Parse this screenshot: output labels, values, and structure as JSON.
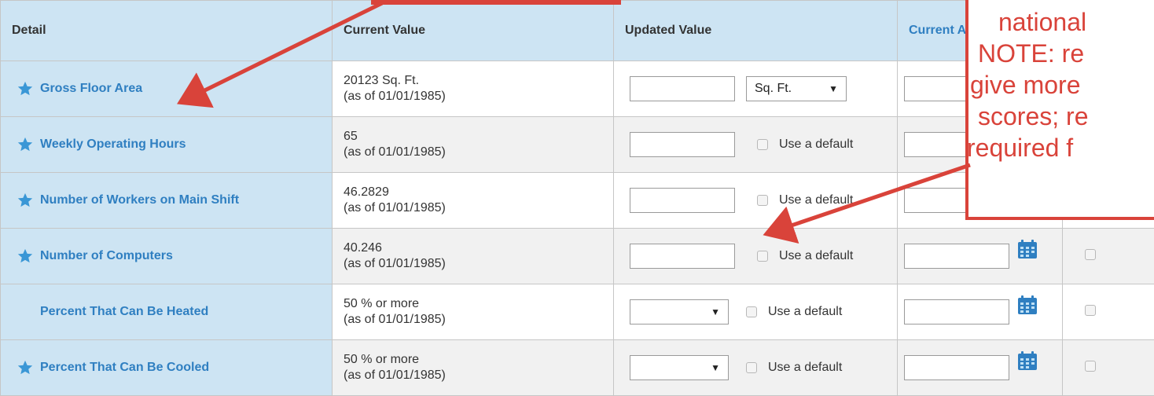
{
  "table": {
    "headers": {
      "detail": "Detail",
      "current_value": "Current Value",
      "updated_value": "Updated Value",
      "current_as_of": "Current As O"
    },
    "rows": [
      {
        "label": "Gross Floor Area",
        "star": true,
        "value": "20123 Sq. Ft.",
        "asof": "(as of 01/01/1985)",
        "kind": "unit",
        "unit": "Sq. Ft.",
        "has_date": false
      },
      {
        "label": "Weekly Operating Hours",
        "star": true,
        "value": "65",
        "asof": "(as of 01/01/1985)",
        "kind": "text_default",
        "default_label": "Use a default",
        "has_date": false
      },
      {
        "label": "Number of Workers on Main Shift",
        "star": true,
        "value": "46.2829",
        "asof": "(as of 01/01/1985)",
        "kind": "text_default",
        "default_label": "Use a default",
        "has_date": false
      },
      {
        "label": "Number of Computers",
        "star": true,
        "value": "40.246",
        "asof": "(as of 01/01/1985)",
        "kind": "text_default",
        "default_label": "Use a default",
        "has_date": true
      },
      {
        "label": "Percent That Can Be Heated",
        "star": false,
        "value": "50 % or more",
        "asof": "(as of 01/01/1985)",
        "kind": "select_default",
        "default_label": "Use a default",
        "has_date": true
      },
      {
        "label": "Percent That Can Be Cooled",
        "star": true,
        "value": "50 % or more",
        "asof": "(as of 01/01/1985)",
        "kind": "select_default",
        "default_label": "Use a default",
        "has_date": true
      }
    ]
  },
  "callout": {
    "lines": [
      "national",
      "NOTE: re",
      "give more",
      "scores; re",
      "required f"
    ],
    "color": "#d9433a"
  },
  "colors": {
    "header_bg": "#cde4f3",
    "link_blue": "#2f7fc1",
    "star_blue": "#3a97d6",
    "annotation_red": "#d9433a"
  },
  "icons": {
    "star": "star-icon",
    "calendar": "calendar-icon",
    "dropdown": "chevron-down-icon"
  }
}
